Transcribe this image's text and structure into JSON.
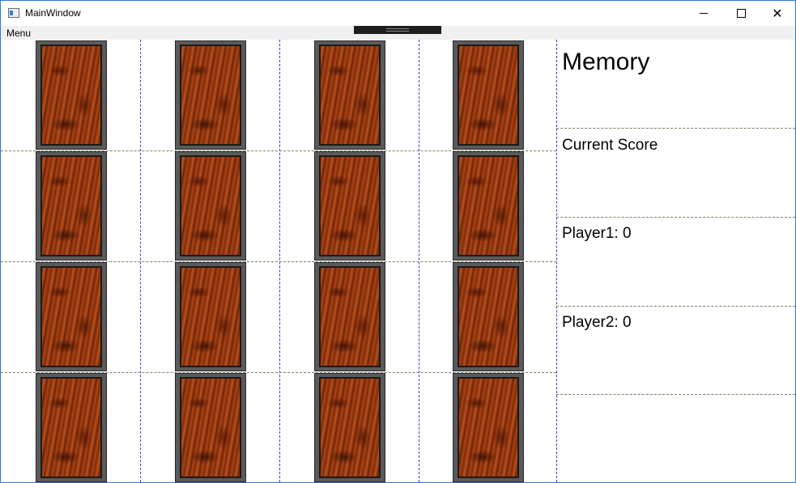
{
  "window": {
    "title": "MainWindow",
    "icon": "window-app-icon",
    "controls": {
      "minimize_icon": "minimize-icon",
      "maximize_icon": "maximize-icon",
      "close_icon": "close-icon",
      "close_glyph": "✕"
    }
  },
  "menu": {
    "items": [
      {
        "label": "Menu"
      }
    ]
  },
  "board": {
    "card_count": 16,
    "card_face": "wood-texture card back",
    "rows": 4,
    "columns": 4
  },
  "sidebar": {
    "title": "Memory",
    "score_heading": "Current Score",
    "player1": "Player1: 0",
    "player2": "Player2: 0"
  },
  "colors": {
    "window_border": "#2b79d6",
    "grid_line": "#3b3bdc",
    "card_wood": "#8a2e0b",
    "card_frame": "#5a5a5a"
  }
}
